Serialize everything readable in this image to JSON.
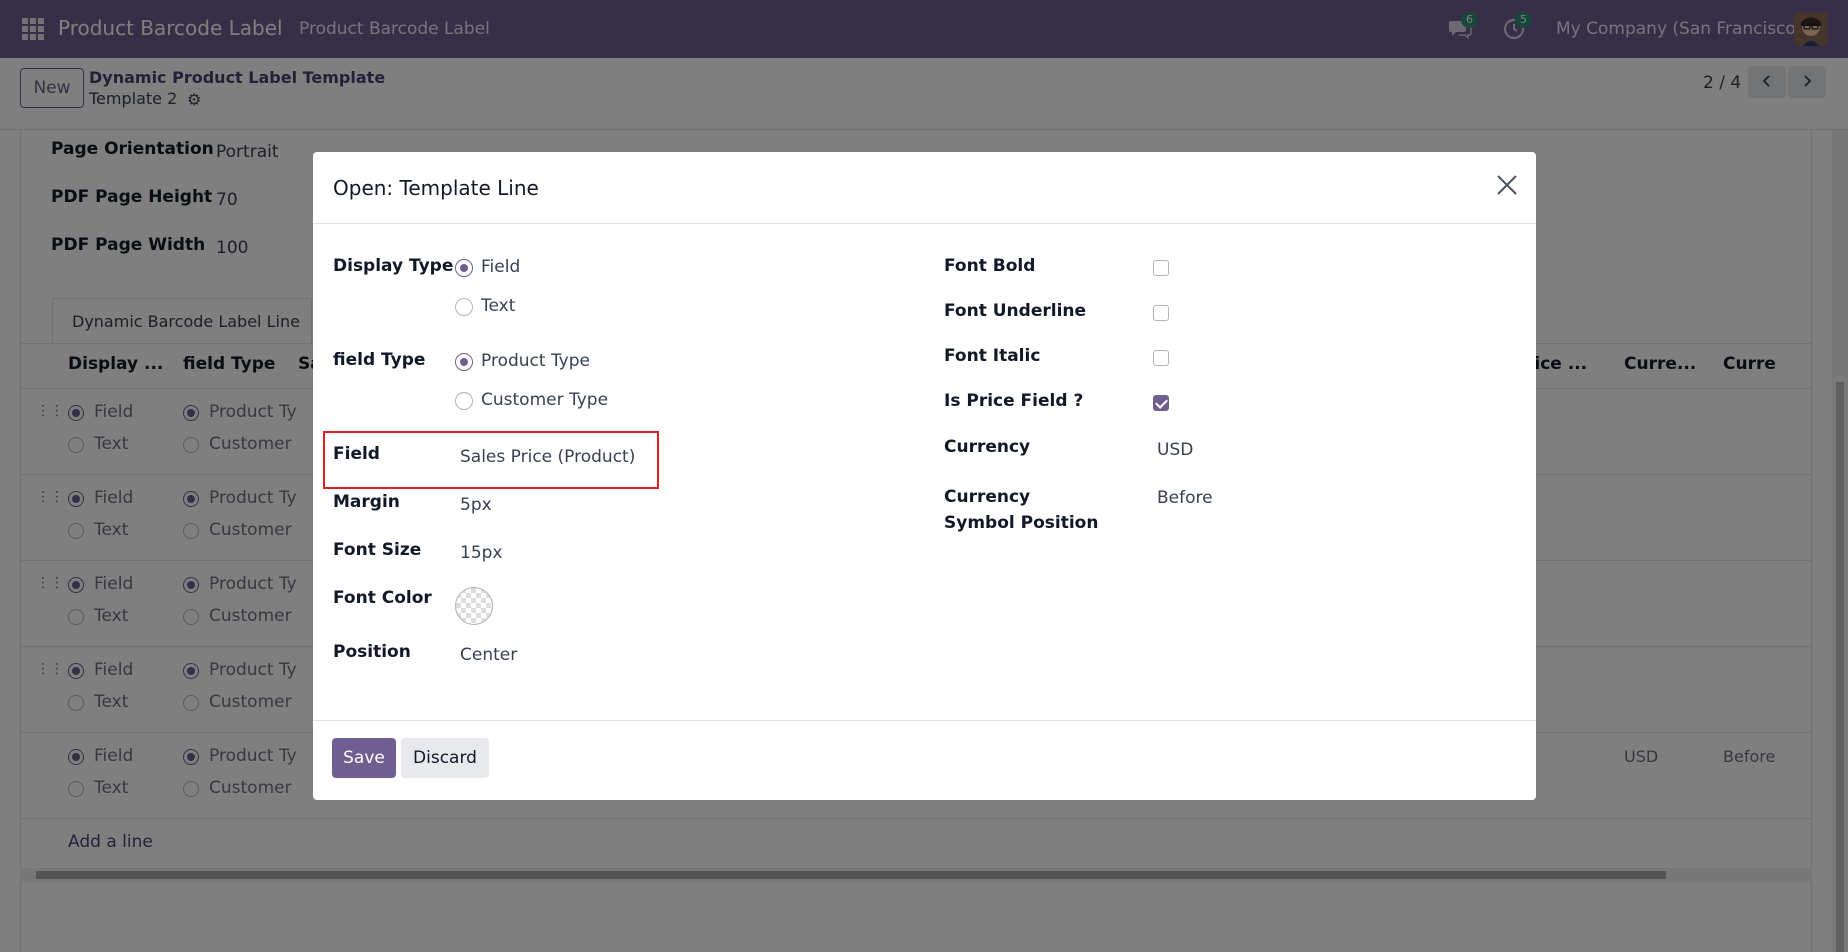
{
  "navbar": {
    "app_name": "Product Barcode Label",
    "menu_item": "Product Barcode Label",
    "messages_count": "6",
    "activities_count": "5",
    "company": "My Company (San Francisco)"
  },
  "control_panel": {
    "new_label": "New",
    "breadcrumb_parent": "Dynamic Product Label Template",
    "breadcrumb_current": "Template 2",
    "pager_value": "2 / 4"
  },
  "background_form": {
    "page_orientation_label": "Page Orientation",
    "page_orientation_value": "Portrait",
    "pdf_height_label": "PDF Page Height",
    "pdf_height_value": "70",
    "pdf_width_label": "PDF Page Width",
    "pdf_width_value": "100",
    "tab_label": "Dynamic Barcode Label Line",
    "columns": [
      "Display ...",
      "field Type",
      "Sa",
      "rice ...",
      "Curre...",
      "Curre"
    ],
    "row_field": "Field",
    "row_text": "Text",
    "row_product": "Product Ty",
    "row_customer": "Customer",
    "last_row_currency": "USD",
    "last_row_position": "Before",
    "add_line": "Add a line"
  },
  "modal": {
    "title": "Open: Template Line",
    "display_type_label": "Display Type",
    "display_type_options": [
      "Field",
      "Text"
    ],
    "field_type_label": "field Type",
    "field_type_options": [
      "Product Type",
      "Customer Type"
    ],
    "field_label": "Field",
    "field_value": "Sales Price (Product)",
    "margin_label": "Margin",
    "margin_value": "5px",
    "font_size_label": "Font Size",
    "font_size_value": "15px",
    "font_color_label": "Font Color",
    "position_label": "Position",
    "position_value": "Center",
    "font_bold_label": "Font Bold",
    "font_underline_label": "Font Underline",
    "font_italic_label": "Font Italic",
    "is_price_label": "Is Price Field ?",
    "currency_label": "Currency",
    "currency_value": "USD",
    "currency_symbol_label": "Currency Symbol Position",
    "currency_symbol_value": "Before",
    "font_bold_checked": false,
    "font_underline_checked": false,
    "font_italic_checked": false,
    "is_price_checked": true,
    "save_label": "Save",
    "discard_label": "Discard"
  },
  "colors": {
    "brand": "#6f5f91",
    "highlight": "#e02020"
  }
}
